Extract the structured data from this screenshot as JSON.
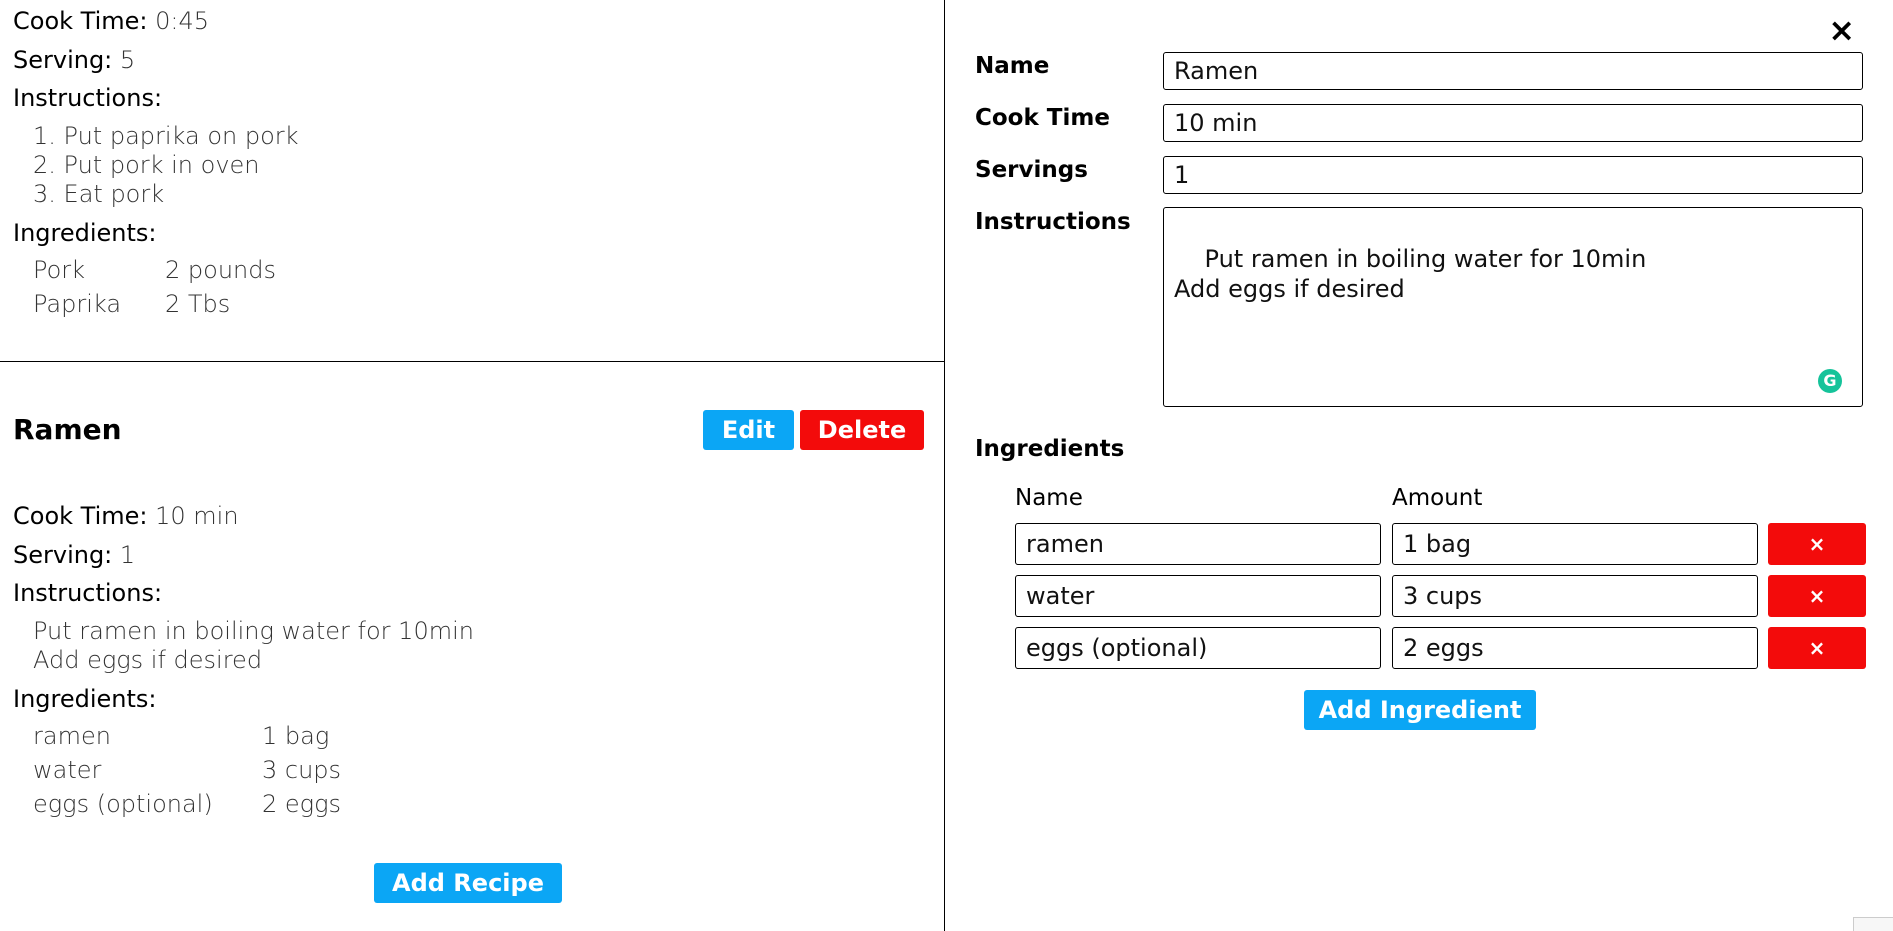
{
  "previous_recipe": {
    "cook_time_label": "Cook Time:",
    "cook_time": "0:45",
    "serving_label": "Serving:",
    "serving": "5",
    "instructions_label": "Instructions:",
    "instructions": [
      "1. Put paprika on pork",
      "2. Put pork in oven",
      "3. Eat pork"
    ],
    "ingredients_label": "Ingredients:",
    "ingredients": [
      {
        "name": "Pork",
        "amount": "2 pounds"
      },
      {
        "name": "Paprika",
        "amount": "2 Tbs"
      }
    ]
  },
  "recipe": {
    "title": "Ramen",
    "edit_label": "Edit",
    "delete_label": "Delete",
    "cook_time_label": "Cook Time:",
    "cook_time": "10 min",
    "serving_label": "Serving:",
    "serving": "1",
    "instructions_label": "Instructions:",
    "instructions": [
      "Put ramen in boiling water for 10min",
      "Add eggs if desired"
    ],
    "ingredients_label": "Ingredients:",
    "ingredients": [
      {
        "name": "ramen",
        "amount": "1 bag"
      },
      {
        "name": "water",
        "amount": "3 cups"
      },
      {
        "name": "eggs (optional)",
        "amount": "2 eggs"
      }
    ]
  },
  "add_recipe_label": "Add Recipe",
  "form": {
    "close_icon": "×",
    "name_label": "Name",
    "name_value": "Ramen",
    "cook_time_label": "Cook Time",
    "cook_time_value": "10 min",
    "servings_label": "Servings",
    "servings_value": "1",
    "instructions_label": "Instructions",
    "instructions_value": "Put ramen in boiling water for 10min\nAdd eggs if desired",
    "grammarly_icon": "G",
    "ingredients_label": "Ingredients",
    "col_name": "Name",
    "col_amount": "Amount",
    "ingredients": [
      {
        "name": "ramen",
        "amount": "1 bag"
      },
      {
        "name": "water",
        "amount": "3 cups"
      },
      {
        "name": "eggs (optional)",
        "amount": "2 eggs"
      }
    ],
    "remove_icon": "×",
    "add_ingredient_label": "Add Ingredient"
  },
  "colors": {
    "accent_blue": "#0ba6f5",
    "danger_red": "#f30b0b",
    "grammarly_green": "#15c39a"
  }
}
